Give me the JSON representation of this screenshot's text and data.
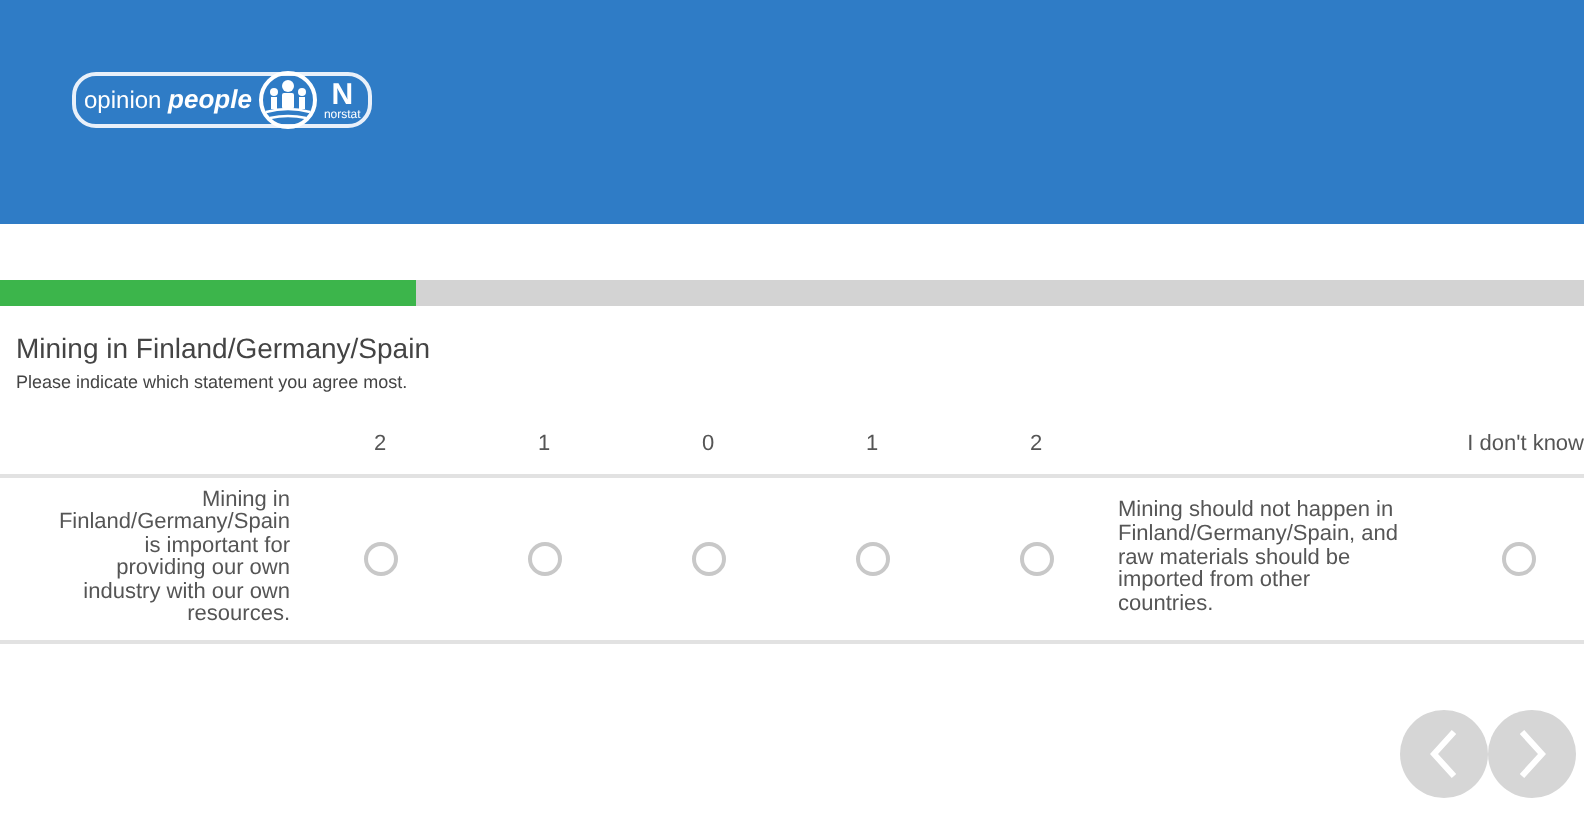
{
  "header": {
    "logo": {
      "brand": "opinion **people**",
      "letter": "N",
      "sub": "norstat"
    }
  },
  "progress": {
    "level": 0.263
  },
  "question": {
    "title": "Mining in Finland/Germany/Spain",
    "instruction": "Please indicate which statement you agree most.",
    "scale": [
      {
        "label": "2",
        "selected": false
      },
      {
        "label": "1",
        "selected": false
      },
      {
        "label": "0",
        "selected": false
      },
      {
        "label": "1",
        "selected": false
      },
      {
        "label": "2",
        "selected": false
      }
    ],
    "left_statement": "Mining in Finland/Germany/Spain is important for providing our own industry with our own resources.",
    "right_statement": "Mining should not happen in Finland/Germany/Spain, and raw materials should be imported from other countries.",
    "dont_know": {
      "label": "I don't know",
      "selected": false
    }
  },
  "navigation": [
    {
      "kind": "back",
      "disabled": true
    },
    {
      "kind": "next",
      "disabled": true
    }
  ]
}
